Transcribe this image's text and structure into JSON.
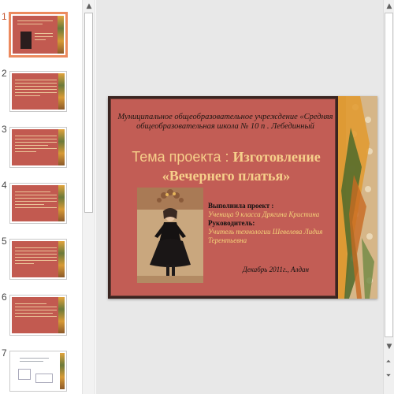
{
  "thumbnails": [
    {
      "number": "1",
      "style": "title",
      "active": true
    },
    {
      "number": "2",
      "style": "text",
      "active": false
    },
    {
      "number": "3",
      "style": "text",
      "active": false
    },
    {
      "number": "4",
      "style": "text",
      "active": false
    },
    {
      "number": "5",
      "style": "text",
      "active": false
    },
    {
      "number": "6",
      "style": "text",
      "active": false
    },
    {
      "number": "7",
      "style": "diagram",
      "active": false
    }
  ],
  "slide": {
    "institution": "Муниципальное общеобразовательное учреждение «Средняя общеобразовательная школа № 10 п . Лебединный",
    "title_prefix": "Тема проекта : ",
    "title_main": "Изготовление «Вечернего платья»",
    "author_label": "Выполнила проект :",
    "author_value": "Ученица 9 класса Дрягина Кристина",
    "supervisor_label": "Руководитель:",
    "supervisor_value": "Учитель технологии Шевелева Лидия Терентьевна",
    "date": "Декабрь 2011г., Алдан"
  },
  "colors": {
    "slide_bg": "#c25d55",
    "title_color": "#f6cf8a",
    "value_color": "#f5d47a",
    "active_thumb_border": "#ec8a5e"
  },
  "icons": {
    "scroll_up": "▲",
    "scroll_down": "▼",
    "prev_slide": "⏶",
    "next_slide": "⏷"
  }
}
